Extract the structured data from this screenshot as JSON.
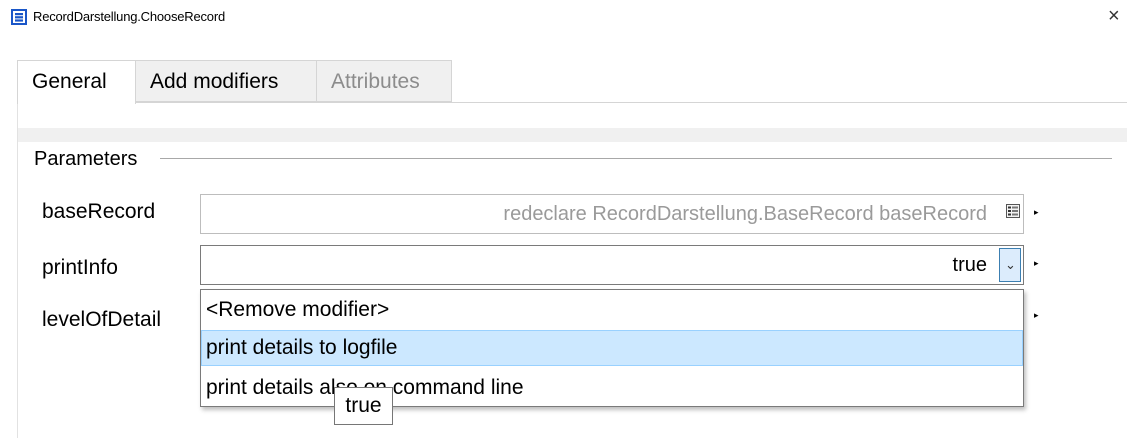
{
  "window": {
    "title": "RecordDarstellung.ChooseRecord",
    "close_label": "×"
  },
  "tabs": [
    {
      "label": "General",
      "state": "active"
    },
    {
      "label": "Add modifiers",
      "state": "inactive"
    },
    {
      "label": "Attributes",
      "state": "disabled"
    }
  ],
  "parameters": {
    "group_label": "Parameters",
    "rows": [
      {
        "label": "baseRecord",
        "value": "redeclare RecordDarstellung.BaseRecord baseRecord"
      },
      {
        "label": "printInfo",
        "value": "true"
      },
      {
        "label": "levelOfDetail",
        "value": ""
      }
    ]
  },
  "dropdown": {
    "items": [
      {
        "label": "<Remove modifier>",
        "highlighted": false
      },
      {
        "label": "print details to logfile",
        "highlighted": true
      },
      {
        "label": "print details also on command line",
        "highlighted": false
      }
    ]
  },
  "tooltip": {
    "text": "true"
  },
  "icons": {
    "app": "record-window-icon",
    "edit": "table-edit-icon",
    "more": "small-right-arrow-icon"
  },
  "colors": {
    "hover_highlight": "#cce8ff",
    "chevron_box": "#dcecfc",
    "disabled_text": "#8c8c8c"
  }
}
